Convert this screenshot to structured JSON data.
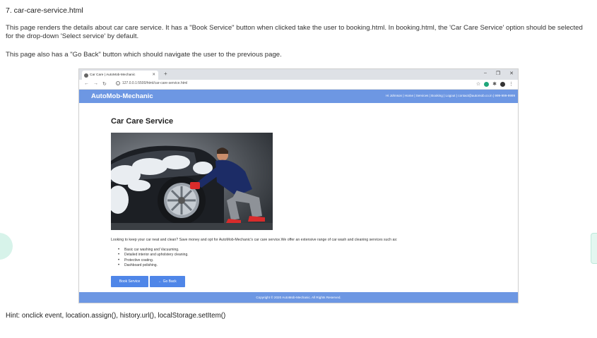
{
  "doc": {
    "heading": "7. car-care-service.html",
    "paragraph1": "This page renders the details about car care service. It has a \"Book Service\" button when clicked take the user to booking.html. In booking.html, the 'Car Care Service' option should be selected for the drop-down 'Select service' by default.",
    "paragraph2": "This page also has a \"Go Back\" button which should navigate the user to the previous page.",
    "hint": "Hint: onclick event, location.assign(), history.url(), localStorage.setItem()"
  },
  "browser": {
    "tab_title": "Car Care | AutoMob-Mechanic",
    "url": "127.0.0.1:5500/html/car-care-service.html"
  },
  "site": {
    "brand": "AutoMob-Mechanic",
    "nav": "Hi Johnson | Home | Services | Booking | Logout | contact@automob.co.in | 999-999-9999",
    "page_title": "Car Care Service",
    "lead": "Looking to keep your car neat and clean? Save money and opt for AutoMob-Mechanic's car care service.We offer an extensive range of car wash and cleaning services such as:",
    "features": [
      "Basic car washing and Vacuuming.",
      "Detailed interior and upholstery cleaning.",
      "Protective coating.",
      "Dashboard polishing."
    ],
    "book_button": "Book Service",
    "back_button": "← Go Back",
    "footer": "Copyright © 2020 AutoMob-Mechanic.  All Rights Reserved."
  },
  "colors": {
    "site_primary": "#6d97e3",
    "button": "#4f86e8"
  }
}
